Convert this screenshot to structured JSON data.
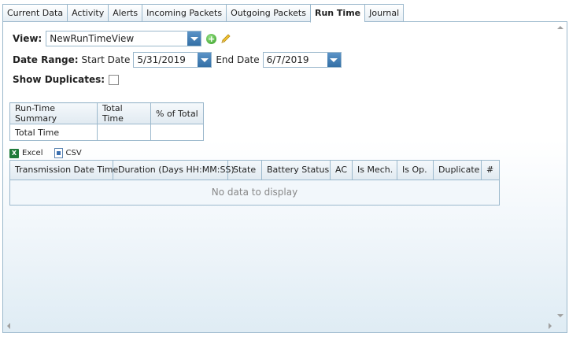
{
  "tabs": [
    {
      "label": "Current Data"
    },
    {
      "label": "Activity"
    },
    {
      "label": "Alerts"
    },
    {
      "label": "Incoming Packets"
    },
    {
      "label": "Outgoing Packets"
    },
    {
      "label": "Run Time",
      "active": true
    },
    {
      "label": "Journal"
    }
  ],
  "view": {
    "label": "View:",
    "value": "NewRunTimeView"
  },
  "date_range": {
    "label": "Date Range:",
    "start_label": "Start Date",
    "start_value": "5/31/2019",
    "end_label": "End Date",
    "end_value": "6/7/2019"
  },
  "show_duplicates": {
    "label": "Show Duplicates:",
    "checked": false
  },
  "summary": {
    "headers": [
      "Run-Time Summary",
      "Total Time",
      "% of Total"
    ],
    "rows": [
      [
        "Total Time",
        "",
        ""
      ]
    ]
  },
  "exports": {
    "excel": "Excel",
    "csv": "CSV"
  },
  "grid": {
    "columns": [
      "Transmission Date Time",
      "Duration (Days HH:MM:SS)",
      "State",
      "Battery Status",
      "AC",
      "Is Mech.",
      "Is Op.",
      "Duplicate",
      "#"
    ],
    "empty_text": "No data to display"
  },
  "colors": {
    "border": "#9bb8cc",
    "accent": "#336fa5",
    "add_icon": "#2f9a1e",
    "excel_icon": "#1f7a3a"
  },
  "icons": {
    "add": "add-circle-icon",
    "edit": "pencil-icon",
    "excel": "excel-icon",
    "csv": "csv-icon"
  }
}
